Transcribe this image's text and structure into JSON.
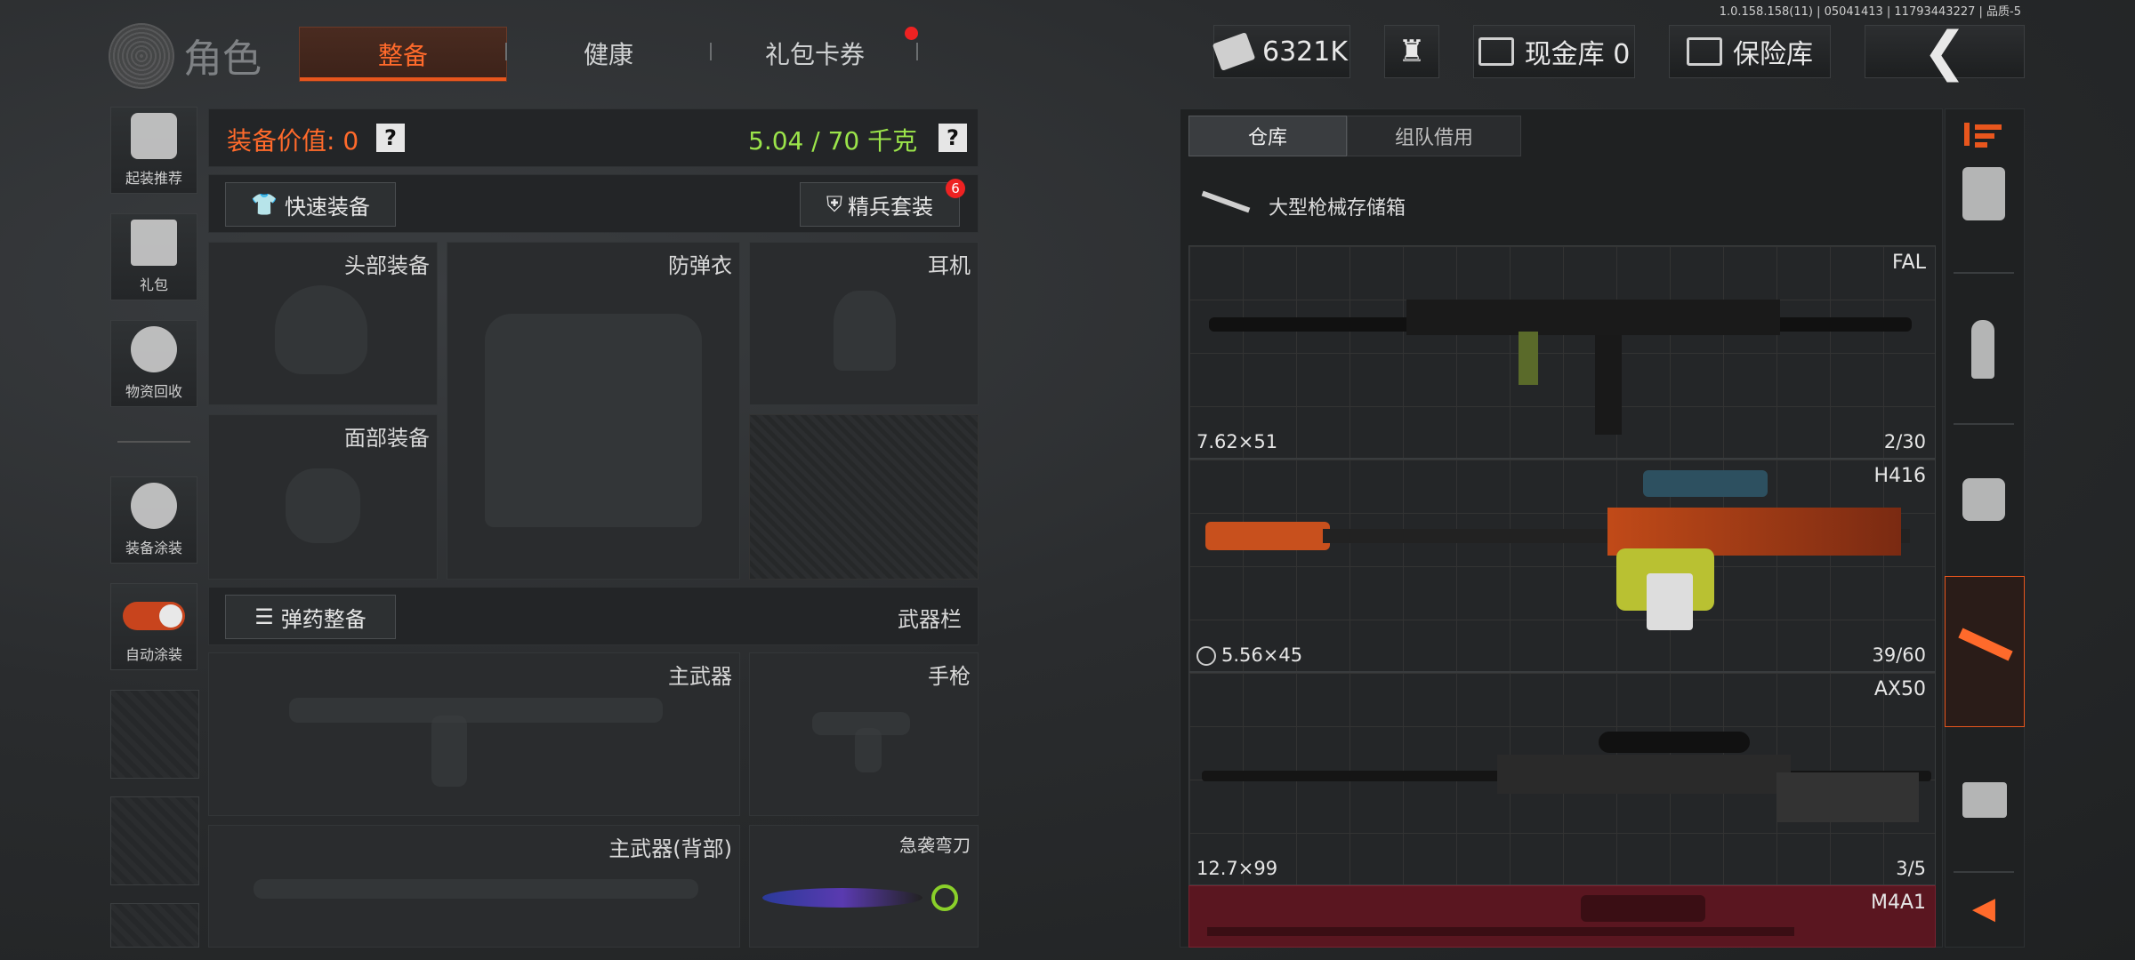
{
  "version": "1.0.158.158(11) | 05041413 | 11793443227 | 品质-5",
  "header": {
    "title": "角色",
    "tabs": [
      {
        "label": "整备",
        "active": true
      },
      {
        "label": "健康",
        "active": false
      },
      {
        "label": "礼包卡券",
        "active": false
      }
    ],
    "currency": "6321K",
    "cash_vault": "现金库 0",
    "safe": "保险库"
  },
  "sidebar": {
    "items": [
      "起装推荐",
      "礼包",
      "物资回收",
      "装备涂装",
      "自动涂装"
    ]
  },
  "loadout": {
    "value_label": "装备价值: 0",
    "weight": "5.04 / 70 千克",
    "quick_equip": "快速装备",
    "elite_set": "精兵套装",
    "elite_badge": "6",
    "slots": {
      "head": "头部装备",
      "armor": "防弹衣",
      "headset": "耳机",
      "face": "面部装备"
    },
    "ammo_button": "弹药整备",
    "weapon_bar": "武器栏",
    "weapon_slots": {
      "primary": "主武器",
      "pistol": "手枪",
      "primary_back": "主武器(背部)",
      "melee": "急袭弯刀"
    }
  },
  "storage": {
    "tabs": [
      {
        "label": "仓库",
        "active": true
      },
      {
        "label": "组队借用",
        "active": false
      }
    ],
    "container": "大型枪械存储箱",
    "weapons": [
      {
        "name": "FAL",
        "caliber": "7.62×51",
        "ammo": "2/30"
      },
      {
        "name": "H416",
        "caliber": "5.56×45",
        "ammo": "39/60"
      },
      {
        "name": "AX50",
        "caliber": "12.7×99",
        "ammo": "3/5"
      },
      {
        "name": "M4A1",
        "caliber": "",
        "ammo": ""
      }
    ]
  },
  "colors": {
    "accent": "#ff6a2b",
    "weight": "#9be44a",
    "alert": "#e22222"
  }
}
